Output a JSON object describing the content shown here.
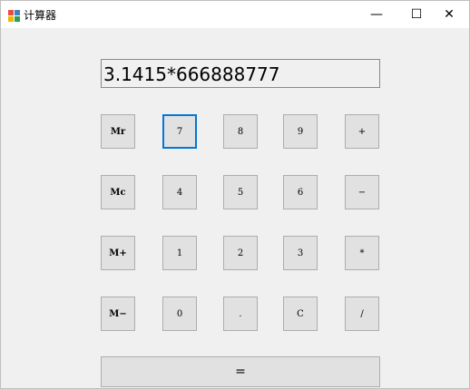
{
  "window": {
    "title": "计算器",
    "controls": {
      "minimize": "—",
      "maximize": "☐",
      "close": "✕"
    }
  },
  "display": {
    "value": "3.1415*666888777"
  },
  "keys": {
    "mr": "Mr",
    "k7": "7",
    "k8": "8",
    "k9": "9",
    "plus": "+",
    "mc": "Mc",
    "k4": "4",
    "k5": "5",
    "k6": "6",
    "minus": "−",
    "mplus": "M+",
    "k1": "1",
    "k2": "2",
    "k3": "3",
    "mul": "*",
    "mminus": "M−",
    "k0": "0",
    "dot": ".",
    "clear": "C",
    "div": "/",
    "equals": "="
  },
  "colors": {
    "focus_border": "#0078d7",
    "button_face": "#e1e1e1",
    "window_bg": "#f0f0f0"
  },
  "icons": {
    "app": "calculator-app-icon"
  }
}
